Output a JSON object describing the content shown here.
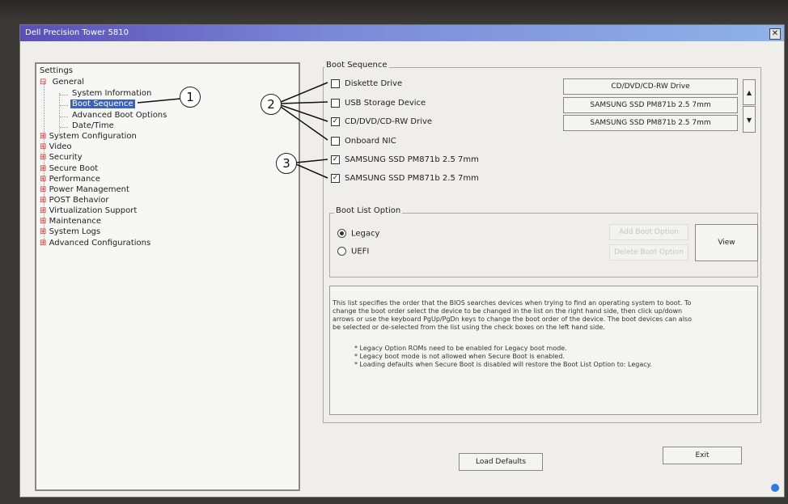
{
  "window": {
    "title": "Dell Precision Tower 5810",
    "close_label": "✕"
  },
  "tree": {
    "root": "Settings",
    "general": "General",
    "general_children": [
      "System Information",
      "Boot Sequence",
      "Advanced Boot Options",
      "Date/Time"
    ],
    "selected": "Boot Sequence",
    "collapsed": [
      "System Configuration",
      "Video",
      "Security",
      "Secure Boot",
      "Performance",
      "Power Management",
      "POST Behavior",
      "Virtualization Support",
      "Maintenance",
      "System Logs",
      "Advanced Configurations"
    ]
  },
  "boot_sequence": {
    "legend": "Boot Sequence",
    "devices": [
      {
        "label": "Diskette Drive",
        "checked": false
      },
      {
        "label": "USB Storage Device",
        "checked": false
      },
      {
        "label": "CD/DVD/CD-RW Drive",
        "checked": true
      },
      {
        "label": "Onboard NIC",
        "checked": false
      },
      {
        "label": "SAMSUNG SSD PM871b 2.5 7mm",
        "checked": true
      },
      {
        "label": "SAMSUNG SSD PM871b 2.5 7mm",
        "checked": true
      }
    ],
    "order": [
      "CD/DVD/CD-RW Drive",
      "SAMSUNG SSD PM871b 2.5 7mm",
      "SAMSUNG SSD PM871b 2.5 7mm"
    ],
    "up_label": "▲",
    "down_label": "▼"
  },
  "boot_list": {
    "legend": "Boot List Option",
    "options": [
      {
        "label": "Legacy",
        "selected": true
      },
      {
        "label": "UEFI",
        "selected": false
      }
    ],
    "add_label": "Add Boot Option",
    "delete_label": "Delete Boot Option",
    "view_label": "View"
  },
  "description": {
    "lines": [
      "This list specifies the order that the BIOS searches devices when trying to find an operating system to boot. To",
      "change the boot order select the device to be changed in the list on the right hand side, then click up/down",
      "arrows or use the keyboard PgUp/PgDn keys to change the boot order of the device. The boot devices can also",
      "be selected or de-selected from the list using the check boxes on the left hand side."
    ],
    "notes": [
      "* Legacy Option ROMs need to be enabled for Legacy boot mode.",
      "* Legacy boot mode is not allowed when Secure Boot is enabled.",
      "* Loading defaults when Secure Boot is disabled will restore the Boot List Option to: Legacy."
    ]
  },
  "footer": {
    "load_defaults": "Load Defaults",
    "exit": "Exit"
  },
  "callouts": [
    "1",
    "2",
    "3"
  ],
  "colors": {
    "title_start": "#5a4fb8",
    "title_end": "#8fb3ea",
    "selection": "#3a62b8"
  }
}
